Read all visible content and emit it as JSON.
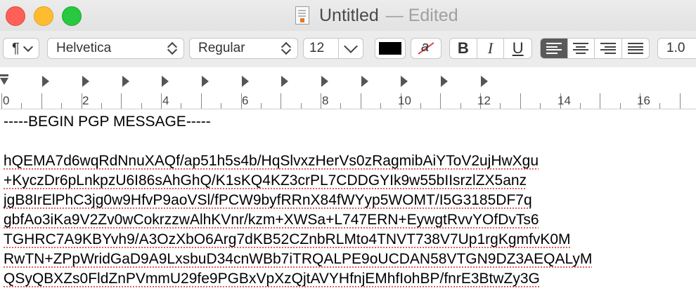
{
  "window": {
    "title": "Untitled",
    "status": "— Edited",
    "doc_icon": "text-document-icon"
  },
  "toolbar": {
    "paragraph_symbol": "¶",
    "font_family": "Helvetica",
    "font_style": "Regular",
    "font_size": "12",
    "text_color": "#000000",
    "highlight_glyph": "a",
    "bold": "B",
    "italic": "I",
    "underline": "U",
    "line_spacing": "1.0"
  },
  "ruler": {
    "numbers": [
      "0",
      "2",
      "4",
      "6",
      "8",
      "10",
      "12",
      "14",
      "16"
    ]
  },
  "document": {
    "lines": [
      "-----BEGIN PGP MESSAGE-----",
      "",
      "hQEMA7d6wqRdNnuXAQf/ap51h5s4b/HqSlvxzHerVs0zRagmibAiYToV2ujHwXgu",
      "+KyczDr6pLnkpzU6I86sAhGhQ/K1sKQ4KZ3crPL7CDDGYIk9w55bIIsrzlZX5anz",
      "jgB8IrElPhC3jg0w9HfvP9aoVSl/fPCW9byfRRnX84fWYyp5WOMT/I5G3185DF7q",
      "gbfAo3iKa9V2Zv0wCokrzzwAlhKVnr/kzm+XWSa+L747ERN+EywgtRvvYOfDvTs6",
      "TGHRC7A9KBYvh9/A3OzXbO6Arg7dKB52CZnbRLMto4TNVT738V7Up1rgKgmfvK0M",
      "RwTN+ZPpWridGaD9A9LxsbuD34cnWBb7iTRQALPE9oUCDAN58VTGN9DZ3AEQALyM",
      "QSyQBXZs0FldZnPVmmU29fe9PGBxVpXzQjtAVYHfnjEMhfIohBP/fnrE3BtwZy3G"
    ]
  }
}
